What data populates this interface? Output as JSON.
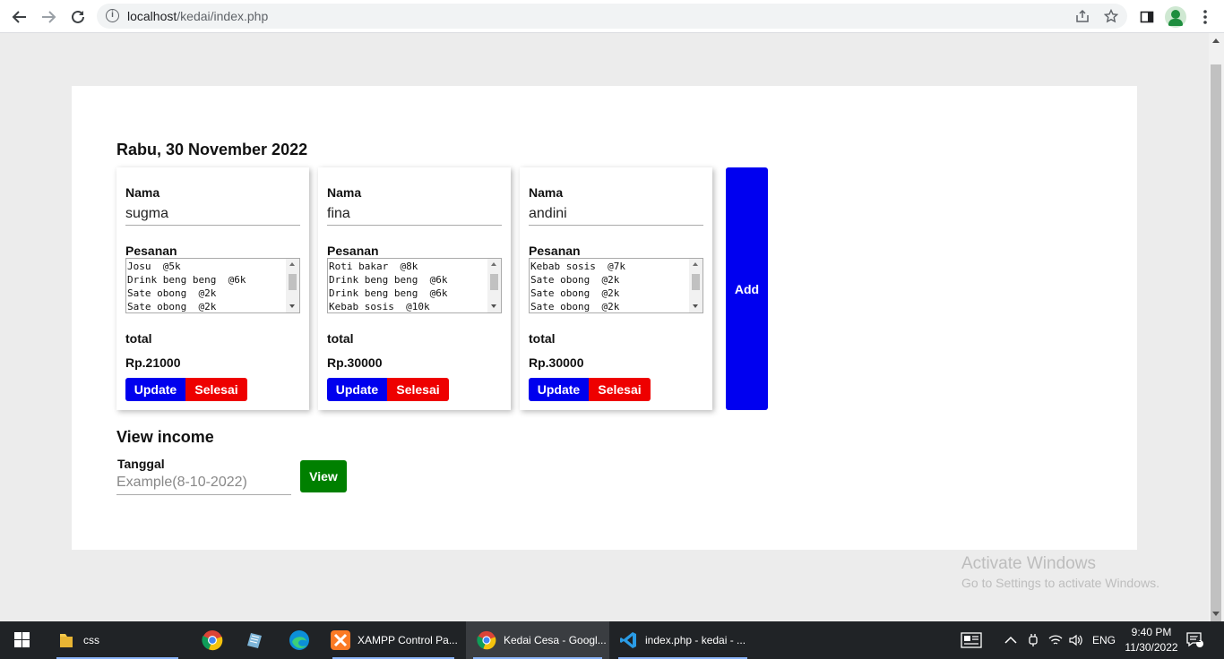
{
  "browser": {
    "url_host": "localhost",
    "url_path": "/kedai/index.php"
  },
  "page": {
    "date_title": "Rabu, 30 November 2022",
    "cards": [
      {
        "name_label": "Nama",
        "name_value": "sugma",
        "orders_label": "Pesanan",
        "orders": "Josu  @5k\nDrink beng beng  @6k\nSate obong  @2k\nSate obong  @2k",
        "total_label": "total",
        "total_value": "Rp.21000",
        "update_label": "Update",
        "selesai_label": "Selesai"
      },
      {
        "name_label": "Nama",
        "name_value": "fina",
        "orders_label": "Pesanan",
        "orders": "Roti bakar  @8k\nDrink beng beng  @6k\nDrink beng beng  @6k\nKebab sosis  @10k",
        "total_label": "total",
        "total_value": "Rp.30000",
        "update_label": "Update",
        "selesai_label": "Selesai"
      },
      {
        "name_label": "Nama",
        "name_value": "andini",
        "orders_label": "Pesanan",
        "orders": "Kebab sosis  @7k\nSate obong  @2k\nSate obong  @2k\nSate obong  @2k",
        "total_label": "total",
        "total_value": "Rp.30000",
        "update_label": "Update",
        "selesai_label": "Selesai"
      }
    ],
    "add_label": "Add",
    "income_title": "View income",
    "tanggal_label": "Tanggal",
    "tanggal_placeholder": "Example(8-10-2022)",
    "view_label": "View"
  },
  "watermark": {
    "line1": "Activate Windows",
    "line2": "Go to Settings to activate Windows."
  },
  "taskbar": {
    "items": [
      {
        "label": "css",
        "icon": "folder-icon"
      },
      {
        "label": "",
        "icon": "chrome-icon"
      },
      {
        "label": "",
        "icon": "notepad-icon"
      },
      {
        "label": "",
        "icon": "edge-icon"
      },
      {
        "label": "XAMPP Control Pa...",
        "icon": "xampp-icon"
      },
      {
        "label": "Kedai Cesa - Googl...",
        "icon": "chrome-icon"
      },
      {
        "label": "index.php - kedai - ...",
        "icon": "vscode-icon"
      }
    ],
    "language": "ENG",
    "time": "9:40 PM",
    "date": "11/30/2022",
    "notification_count": "1"
  },
  "colors": {
    "update": "#0000ee",
    "selesai": "#ee0000",
    "add": "#0000f0",
    "view": "#008000"
  }
}
